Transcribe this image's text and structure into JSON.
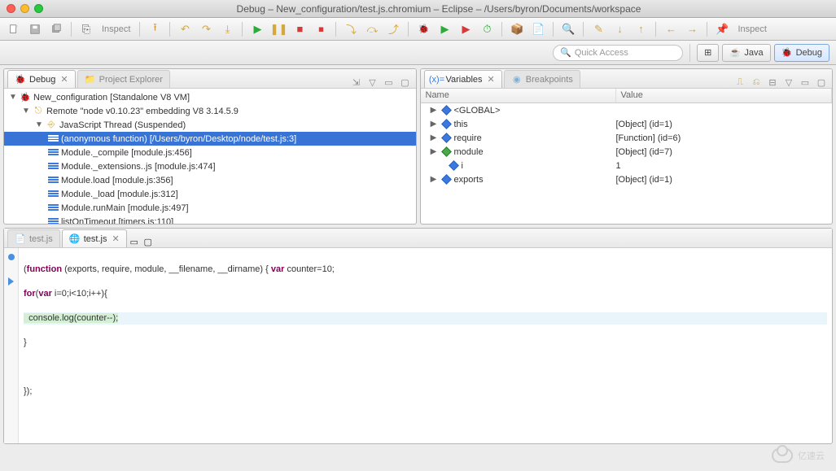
{
  "window": {
    "title": "Debug – New_configuration/test.js.chromium – Eclipse – /Users/byron/Documents/workspace"
  },
  "toolbar": {
    "inspect_label": "Inspect"
  },
  "quick_access": {
    "placeholder": "Quick Access"
  },
  "perspectives": {
    "java": "Java",
    "debug": "Debug"
  },
  "debug_view": {
    "tab_debug": "Debug",
    "tab_project_explorer": "Project Explorer",
    "tree": {
      "config": "New_configuration [Standalone V8 VM]",
      "remote": "Remote \"node v0.10.23\" embedding V8 3.14.5.9",
      "thread": "JavaScript Thread (Suspended)",
      "frames": [
        "(anonymous function) [/Users/byron/Desktop/node/test.js:3]",
        "Module._compile [module.js:456]",
        "Module._extensions..js [module.js:474]",
        "Module.load [module.js:356]",
        "Module._load [module.js:312]",
        "Module.runMain [module.js:497]",
        "listOnTimeout [timers.js:110]"
      ]
    }
  },
  "variables_view": {
    "tab_variables": "Variables",
    "tab_breakpoints": "Breakpoints",
    "col_name": "Name",
    "col_value": "Value",
    "rows": [
      {
        "name": "<GLOBAL>",
        "value": ""
      },
      {
        "name": "this",
        "value": "[Object]  (id=1)"
      },
      {
        "name": "require",
        "value": "[Function]  (id=6)"
      },
      {
        "name": "module",
        "value": "[Object]  (id=7)"
      },
      {
        "name": "i",
        "value": "1"
      },
      {
        "name": "exports",
        "value": "[Object]  (id=1)"
      }
    ]
  },
  "editor": {
    "tab_inactive": "test.js",
    "tab_active": "test.js",
    "code": {
      "l1a": "(",
      "l1b": "function",
      "l1c": " (exports, require, module, __filename, __dirname) { ",
      "l1d": "var",
      "l1e": " counter=10;",
      "l2a": "for",
      "l2b": "(",
      "l2c": "var",
      "l2d": " i=0;i<10;i++){",
      "l3": "  console.log(counter--);",
      "l4": "}",
      "l5": "});"
    }
  },
  "watermark": "亿速云"
}
